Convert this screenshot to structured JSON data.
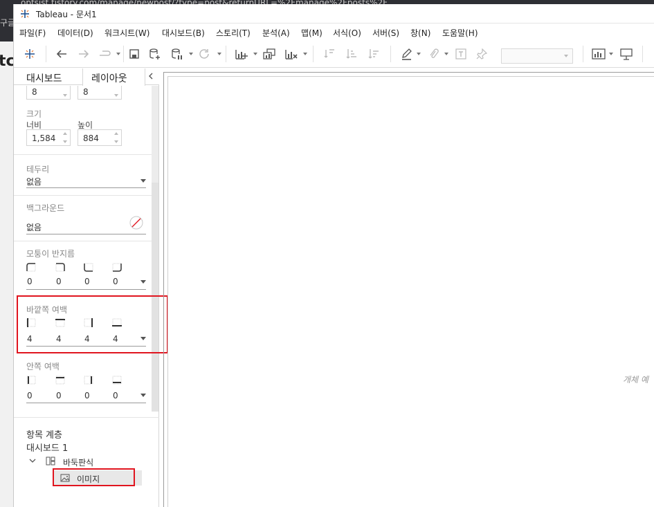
{
  "app": {
    "title": "Tableau - 문서1"
  },
  "background": {
    "url_fragment": "optsist.tistory.com/manage/newpost/?type=post&returnURL=%2Fmanage%2Fposts%2F",
    "left_text": "구글",
    "left_big": "tc"
  },
  "menu": [
    {
      "label": "파일(F)"
    },
    {
      "label": "데이터(D)"
    },
    {
      "label": "워크시트(W)"
    },
    {
      "label": "대시보드(B)"
    },
    {
      "label": "스토리(T)"
    },
    {
      "label": "분석(A)"
    },
    {
      "label": "맵(M)"
    },
    {
      "label": "서식(O)"
    },
    {
      "label": "서버(S)"
    },
    {
      "label": "창(N)"
    },
    {
      "label": "도움말(H)"
    }
  ],
  "tabs": {
    "dashboard": "대시보드",
    "layout": "레이아웃"
  },
  "position": {
    "x": "8",
    "y": "8"
  },
  "size": {
    "label": "크기",
    "width_label": "너비",
    "height_label": "높이",
    "width": "1,584",
    "height": "884"
  },
  "border": {
    "label": "테두리",
    "value": "없음"
  },
  "background_setting": {
    "label": "백그라운드",
    "value": "없음"
  },
  "corner_radius": {
    "label": "모퉁이 반지름",
    "values": [
      "0",
      "0",
      "0",
      "0"
    ]
  },
  "outer_padding": {
    "label": "바깥쪽 여백",
    "values": [
      "4",
      "4",
      "4",
      "4"
    ]
  },
  "inner_padding": {
    "label": "안쪽 여백",
    "values": [
      "0",
      "0",
      "0",
      "0"
    ]
  },
  "hierarchy": {
    "title": "항목 계층",
    "dashboard": "대시보드 1",
    "tiled": "바둑판식",
    "image": "이미지"
  },
  "canvas": {
    "hint": "개체 예"
  },
  "colors": {
    "highlight": "#e0141e",
    "accent": "#1f77b4"
  }
}
